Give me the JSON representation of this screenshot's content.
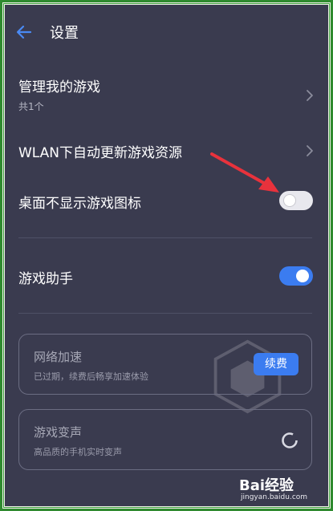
{
  "header": {
    "title": "设置"
  },
  "settings": {
    "manage_games": {
      "label": "管理我的游戏",
      "sub": "共1个"
    },
    "wlan_update": {
      "label": "WLAN下自动更新游戏资源"
    },
    "hide_icon": {
      "label": "桌面不显示游戏图标",
      "enabled": false
    },
    "game_assistant": {
      "label": "游戏助手",
      "enabled": true
    }
  },
  "cards": {
    "network": {
      "title": "网络加速",
      "sub": "已过期，续费后畅享加速体验",
      "button": "续费"
    },
    "voice": {
      "title": "游戏变声",
      "sub": "高品质的手机实时变声"
    }
  },
  "watermark": {
    "brand": "Bai经验",
    "url": "jingyan.baidu.com"
  },
  "colors": {
    "accent": "#3b7cf0",
    "background": "#3a3b4f",
    "annotation_arrow": "#e8323c"
  }
}
